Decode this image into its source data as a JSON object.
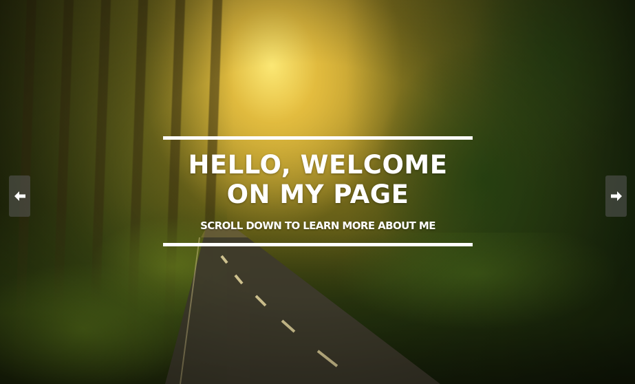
{
  "hero": {
    "headline_line1": "HELLO, WELCOME",
    "headline_line2": "ON MY PAGE",
    "subline": "SCROLL DOWN TO LEARN MORE ABOUT ME"
  },
  "carousel": {
    "prev_icon": "arrow-left-icon",
    "next_icon": "arrow-right-icon"
  },
  "colors": {
    "text": "#ffffff",
    "rule": "#ffffff",
    "arrow_bg": "#5a5a5a"
  }
}
